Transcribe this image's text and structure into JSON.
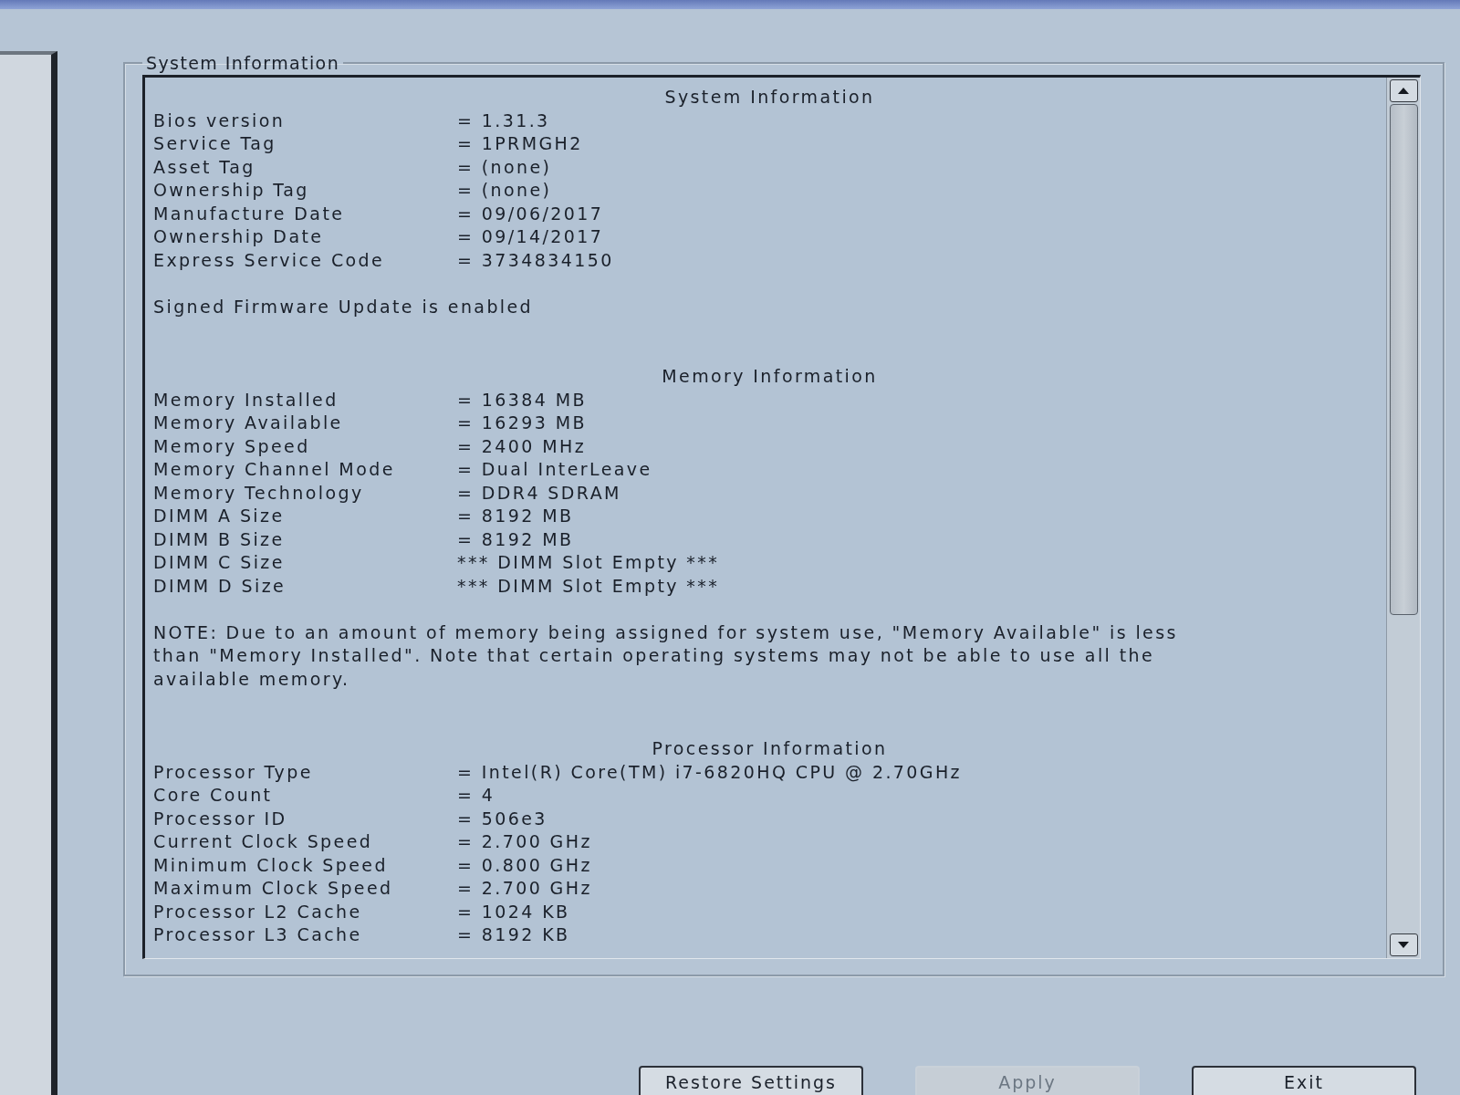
{
  "group_box": {
    "title": "System Information",
    "sections": [
      {
        "heading": "System Information",
        "rows": [
          {
            "label": "Bios version",
            "value": "= 1.31.3"
          },
          {
            "label": "Service Tag",
            "value": "= 1PRMGH2"
          },
          {
            "label": "Asset Tag",
            "value": "= (none)"
          },
          {
            "label": "Ownership Tag",
            "value": "= (none)"
          },
          {
            "label": "Manufacture Date",
            "value": "= 09/06/2017"
          },
          {
            "label": "Ownership Date",
            "value": "= 09/14/2017"
          },
          {
            "label": "Express Service Code",
            "value": "= 3734834150"
          }
        ],
        "note": "Signed Firmware Update is enabled"
      },
      {
        "heading": "Memory Information",
        "rows": [
          {
            "label": "Memory Installed",
            "value": "= 16384 MB"
          },
          {
            "label": "Memory Available",
            "value": "= 16293 MB"
          },
          {
            "label": "Memory Speed",
            "value": "= 2400 MHz"
          },
          {
            "label": "Memory Channel Mode",
            "value": "= Dual InterLeave"
          },
          {
            "label": "Memory Technology",
            "value": "= DDR4 SDRAM"
          },
          {
            "label": "DIMM A Size",
            "value": "= 8192 MB"
          },
          {
            "label": "DIMM B Size",
            "value": "= 8192 MB"
          },
          {
            "label": "DIMM C Size",
            "value": "*** DIMM Slot Empty ***"
          },
          {
            "label": "DIMM D Size",
            "value": "*** DIMM Slot Empty ***"
          }
        ],
        "note": "NOTE: Due to an amount of memory being assigned for system use, \"Memory Available\" is less than \"Memory Installed\". Note that certain operating systems may not be able to use all the available memory."
      },
      {
        "heading": "Processor Information",
        "rows": [
          {
            "label": "Processor Type",
            "value": "= Intel(R) Core(TM) i7-6820HQ CPU @ 2.70GHz"
          },
          {
            "label": "Core Count",
            "value": "= 4"
          },
          {
            "label": "Processor ID",
            "value": "= 506e3"
          },
          {
            "label": "Current Clock Speed",
            "value": "= 2.700 GHz"
          },
          {
            "label": "Minimum Clock Speed",
            "value": "= 0.800 GHz"
          },
          {
            "label": "Maximum Clock Speed",
            "value": "= 2.700 GHz"
          },
          {
            "label": "Processor L2 Cache",
            "value": "= 1024 KB"
          },
          {
            "label": "Processor L3 Cache",
            "value": "= 8192 KB"
          }
        ]
      }
    ]
  },
  "buttons": [
    {
      "label": "Restore Settings",
      "disabled": false
    },
    {
      "label": "Apply",
      "disabled": true
    },
    {
      "label": "Exit",
      "disabled": false
    }
  ]
}
